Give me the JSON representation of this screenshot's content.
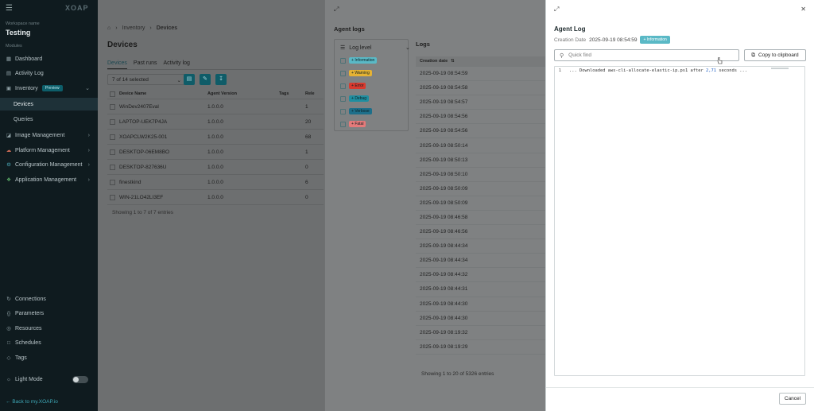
{
  "sidebar": {
    "logo": "XOAP",
    "workspace_label": "Workspace name",
    "workspace_name": "Testing",
    "modules_label": "Modules",
    "items": [
      {
        "label": "Dashboard",
        "icon": "dashboard-icon"
      },
      {
        "label": "Activity Log",
        "icon": "activity-icon"
      },
      {
        "label": "Inventory",
        "icon": "inventory-icon",
        "badge": "Preview"
      },
      {
        "label": "Devices"
      },
      {
        "label": "Queries"
      },
      {
        "label": "Image Management",
        "icon": "image-icon"
      },
      {
        "label": "Platform Management",
        "icon": "cloud-icon"
      },
      {
        "label": "Configuration Management",
        "icon": "config-icon"
      },
      {
        "label": "Application Management",
        "icon": "app-icon"
      }
    ],
    "bottom_items": [
      {
        "label": "Connections",
        "icon": "connections-icon"
      },
      {
        "label": "Parameters",
        "icon": "parameters-icon"
      },
      {
        "label": "Resources",
        "icon": "resources-icon"
      },
      {
        "label": "Schedules",
        "icon": "schedules-icon"
      },
      {
        "label": "Tags",
        "icon": "tags-icon"
      }
    ],
    "light_mode_label": "Light Mode",
    "back_link": "Back to my.XOAP.io"
  },
  "main": {
    "breadcrumb": [
      "Inventory",
      "Devices"
    ],
    "title": "Devices",
    "tabs": [
      "Devices",
      "Past runs",
      "Activity log"
    ],
    "selected_text": "7 of 14 selected",
    "columns": [
      "Device Name",
      "Agent Version",
      "Tags",
      "Rele"
    ],
    "rows": [
      {
        "name": "WinDev2407Eval",
        "version": "1.0.0.0",
        "tags": "",
        "rel": "1"
      },
      {
        "name": "LAPTOP-UEK7P4JA",
        "version": "1.0.0.0",
        "tags": "",
        "rel": "20"
      },
      {
        "name": "XOAPCLW2K25-001",
        "version": "1.0.0.0",
        "tags": "",
        "rel": "68"
      },
      {
        "name": "DESKTOP-06EM8BO",
        "version": "1.0.0.0",
        "tags": "",
        "rel": "1"
      },
      {
        "name": "DESKTOP-827636U",
        "version": "1.0.0.0",
        "tags": "",
        "rel": "0"
      },
      {
        "name": "finestkind",
        "version": "1.0.0.0",
        "tags": "",
        "rel": "6"
      },
      {
        "name": "WIN-21LO42LI3EF",
        "version": "1.0.0.0",
        "tags": "",
        "rel": "0"
      }
    ],
    "footer": "Showing 1 to 7 of 7 entries"
  },
  "agent_logs": {
    "title": "Agent logs",
    "level_label": "Log level",
    "levels": [
      {
        "label": "Information",
        "color": "#5ab9c6"
      },
      {
        "label": "Warning",
        "color": "#e5b233"
      },
      {
        "label": "Error",
        "color": "#d83a2f"
      },
      {
        "label": "Debug",
        "color": "#1f8ea0"
      },
      {
        "label": "Verbose",
        "color": "#1d6f8a"
      },
      {
        "label": "Fatal",
        "color": "#e57a7a"
      }
    ],
    "logs_title": "Logs",
    "column": "Creation date",
    "dates": [
      "2025-09-19 08:54:59",
      "2025-09-19 08:54:58",
      "2025-09-19 08:54:57",
      "2025-09-19 08:54:56",
      "2025-09-19 08:54:56",
      "2025-09-19 08:50:14",
      "2025-09-19 08:50:13",
      "2025-09-19 08:50:10",
      "2025-09-19 08:50:09",
      "2025-09-19 08:50:09",
      "2025-09-19 08:46:58",
      "2025-09-19 08:46:56",
      "2025-09-19 08:44:34",
      "2025-09-19 08:44:34",
      "2025-09-19 08:44:32",
      "2025-09-19 08:44:31",
      "2025-09-19 08:44:30",
      "2025-09-19 08:44:30",
      "2025-09-19 08:19:32",
      "2025-09-19 08:19:29"
    ],
    "footer": "Showing 1 to 20 of 5326 entries"
  },
  "agent_log": {
    "title": "Agent Log",
    "creation_label": "Creation Date",
    "creation_value": "2025-09-19 08:54:59",
    "level_badge": "Information",
    "search_placeholder": "Quick find",
    "copy_label": "Copy to clipboard",
    "line_no": "1",
    "line_pre": "... Downloaded aws-cli-allocate-elastic-ip.ps1 after ",
    "line_num": "2,71",
    "line_post": " seconds ...",
    "cancel_label": "Cancel"
  }
}
